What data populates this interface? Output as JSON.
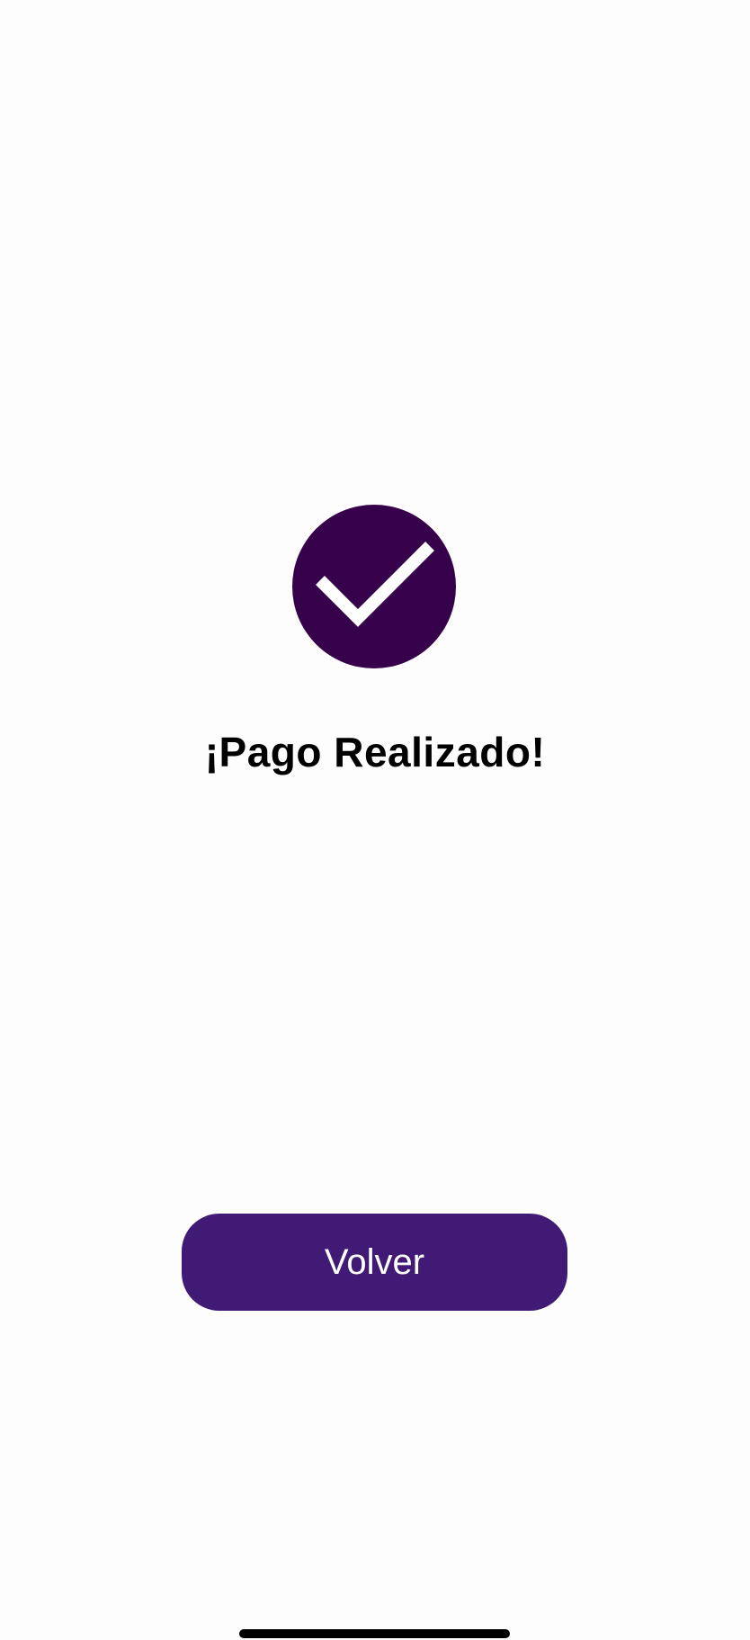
{
  "status": {
    "icon": "checkmark-icon",
    "icon_color": "#36004a",
    "title": "¡Pago Realizado!"
  },
  "actions": {
    "back_label": "Volver",
    "button_color": "#401a74"
  }
}
